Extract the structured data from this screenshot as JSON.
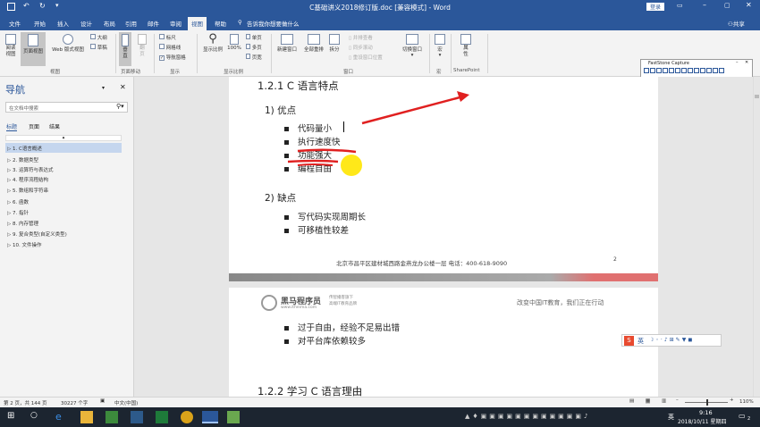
{
  "window": {
    "title": "C基础讲义2018修订版.doc [兼容模式] - Word",
    "login": "登录",
    "share": "共享"
  },
  "tabs": [
    "文件",
    "开始",
    "插入",
    "设计",
    "布局",
    "引用",
    "邮件",
    "审阅",
    "视图",
    "帮助"
  ],
  "active_tab_index": 8,
  "tell_me": "告诉我你想要做什么",
  "ribbon": {
    "views": [
      "阅读\n视图",
      "页面视图",
      "Web 版式视图"
    ],
    "outline": "大纲",
    "draft": "草稿",
    "views_group": "视图",
    "page_move": [
      "垂直",
      "翻页"
    ],
    "page_move_group": "页面移动",
    "show": [
      "标尺",
      "网格线",
      "导航窗格"
    ],
    "show_checked": [
      false,
      false,
      true
    ],
    "show_group": "显示",
    "zoom": [
      "显示比例",
      "100%"
    ],
    "zoom_pages": [
      "单页",
      "多页",
      "页宽"
    ],
    "zoom_group": "显示比例",
    "window_btns": [
      "新建窗口",
      "全部重排",
      "拆分"
    ],
    "window_small": [
      "并排查看",
      "同步滚动",
      "重设窗口位置"
    ],
    "switch_window": "切换窗口",
    "window_group": "窗口",
    "macro": "宏",
    "macro_group": "宏",
    "properties": "属性",
    "sharepoint_group": "SharePoint"
  },
  "faststone": {
    "title": "FastStone Capture"
  },
  "nav": {
    "title": "导航",
    "search_placeholder": "在文档中搜索",
    "tabs": [
      "标题",
      "页面",
      "结果"
    ],
    "items": [
      "1. C语言概述",
      "2. 数据类型",
      "3. 运算符与表达式",
      "4. 程序流程结构",
      "5. 数组和字符串",
      "6. 函数",
      "7. 指针",
      "8. 内存管理",
      "9. 复合类型(自定义类型)",
      "10. 文件操作"
    ]
  },
  "doc": {
    "heading1": "1.2.1 C 语言特点",
    "adv_title": "1) 优点",
    "adv": [
      "代码量小",
      "执行速度快",
      "功能强大",
      "编程自由"
    ],
    "dis_title": "2) 缺点",
    "dis": [
      "写代码实现周期长",
      "可移植性较差"
    ],
    "footer": "北京市昌平区建材城西路金燕龙办公楼一层    电话：400-618-9090",
    "page_num": "2",
    "brand_cn": "黑马程序员",
    "brand_slogan1": "传智播客旗下",
    "brand_slogan2": "高端IT教育品牌",
    "brand_url": "www.itheima.com",
    "header_right": "改变中国IT教育，我们正在行动",
    "cont": [
      "过于自由，经验不足易出错",
      "对平台库依赖较多"
    ],
    "heading2": "1.2.2 学习 C 语言理由"
  },
  "ime": {
    "label": "英"
  },
  "status": {
    "page": "第 2 页，共 144 页",
    "words": "30227 个字",
    "lang": "中文(中国)",
    "zoom": "110%"
  },
  "taskbar": {
    "time": "9:16",
    "date": "2018/10/11 星期四",
    "lang": "英",
    "notif": "2"
  },
  "colors": {
    "word_blue": "#2b579a",
    "annotation_red": "#e02020",
    "highlight_yellow": "#ffe600"
  }
}
